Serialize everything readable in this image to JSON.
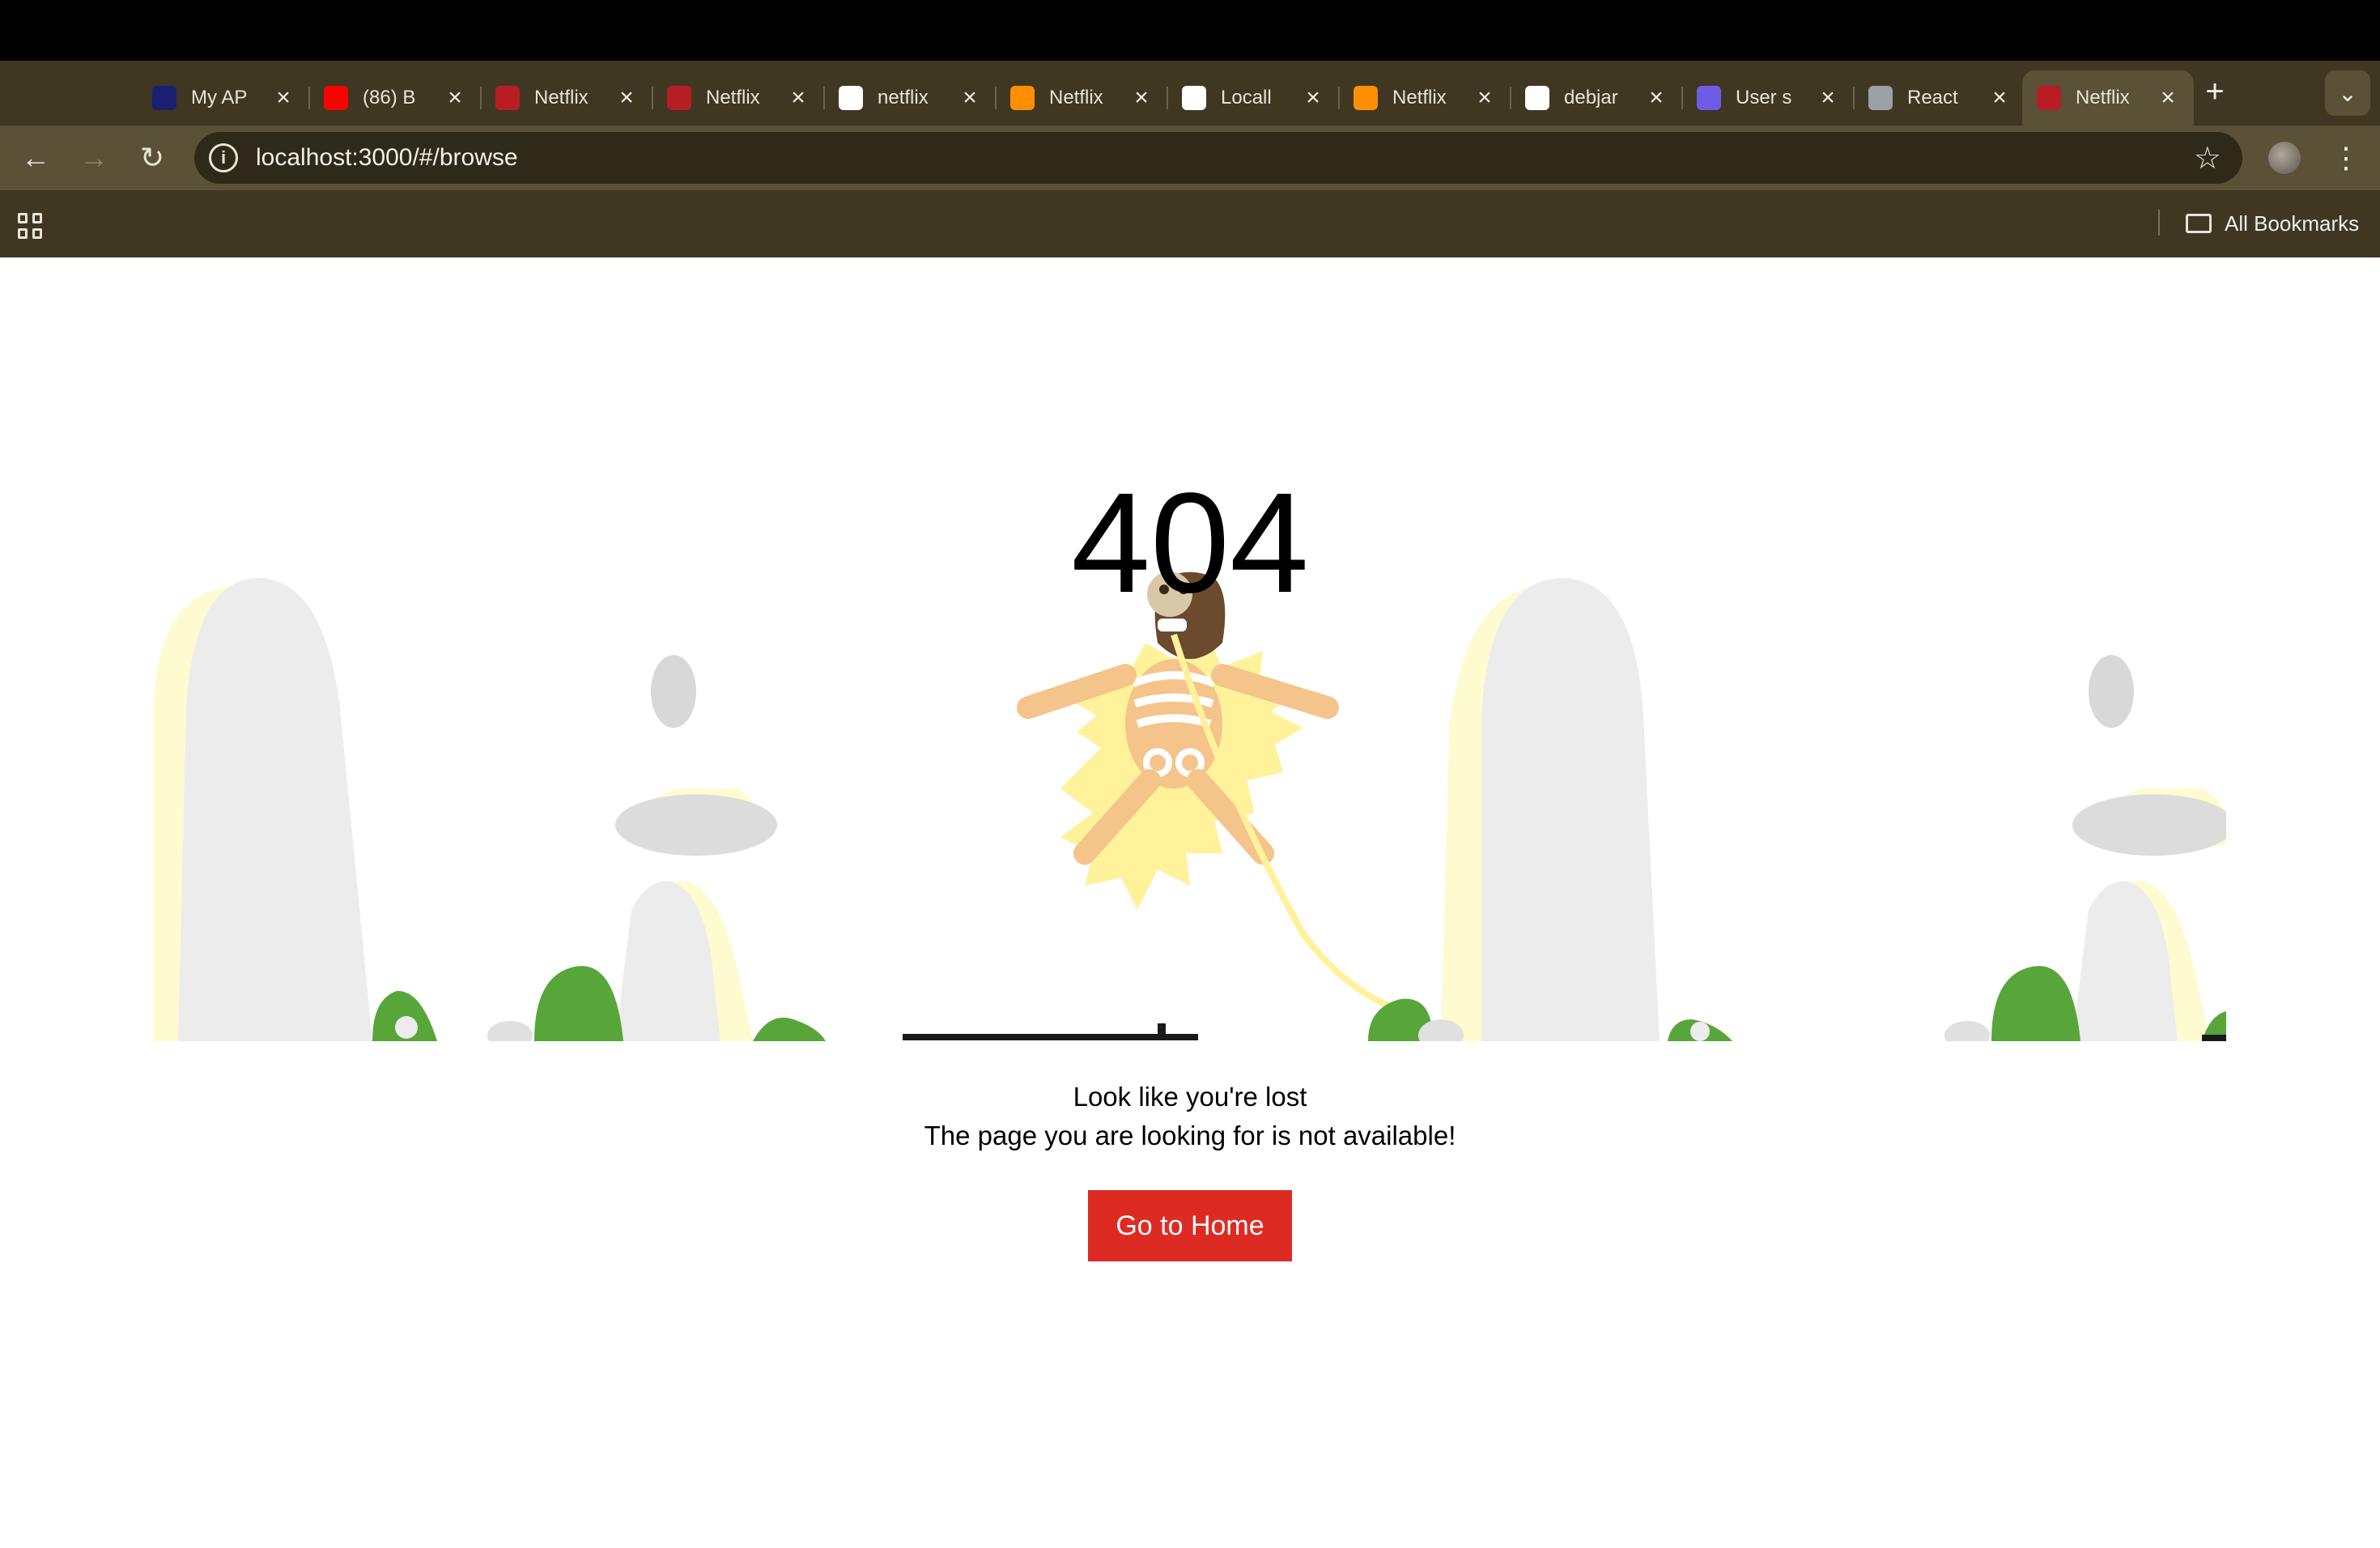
{
  "browser": {
    "tabs": [
      {
        "label": "My AP",
        "icon": "api-icon",
        "color": "#1a1f71"
      },
      {
        "label": "(86) B",
        "icon": "youtube-icon",
        "color": "#ff0000"
      },
      {
        "label": "Netflix",
        "icon": "netflix-icon",
        "color": "#b81d24"
      },
      {
        "label": "Netflix",
        "icon": "netflix-icon",
        "color": "#b81d24"
      },
      {
        "label": "netflix",
        "icon": "github-icon",
        "color": "#ffffff"
      },
      {
        "label": "Netflix",
        "icon": "firebase-icon",
        "color": "#ff8f00"
      },
      {
        "label": "Locall",
        "icon": "chatgpt-icon",
        "color": "#ffffff"
      },
      {
        "label": "Netflix",
        "icon": "firebase-icon",
        "color": "#ff8f00"
      },
      {
        "label": "debjar",
        "icon": "github-icon",
        "color": "#ffffff"
      },
      {
        "label": "User s",
        "icon": "chatgpt-icon",
        "color": "#6e5ce6"
      },
      {
        "label": "React",
        "icon": "globe-icon",
        "color": "#9aa0a6"
      },
      {
        "label": "Netflix",
        "icon": "netflix-icon",
        "color": "#b81d24",
        "active": true
      }
    ],
    "url": "localhost:3000/#/browse",
    "all_bookmarks": "All Bookmarks",
    "new_tab": "+",
    "tab_menu": "⌄"
  },
  "page": {
    "code": "404",
    "line1": "Look like you're lost",
    "line2": "The page you are looking for is not available!",
    "button": "Go to Home",
    "accent": "#dd2b24"
  }
}
